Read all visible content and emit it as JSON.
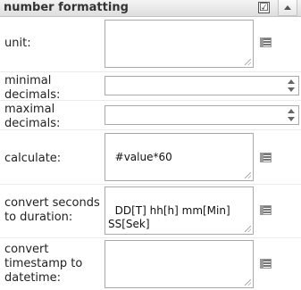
{
  "header": {
    "title": "number formatting",
    "checkbox_glyph": "☑",
    "collapse_icon": "triangle-up"
  },
  "fields": {
    "unit": {
      "label": "unit:",
      "value": ""
    },
    "minimal_decimals": {
      "label": "minimal\ndecimals:",
      "value": ""
    },
    "maximal_decimals": {
      "label": "maximal\ndecimals:",
      "value": ""
    },
    "calculate": {
      "label": "calculate:",
      "value": "#value*60"
    },
    "convert_seconds": {
      "label": "convert seconds\nto duration:",
      "value": "DD[T] hh[h] mm[Min]\nSS[Sek]"
    },
    "convert_timestamp": {
      "label": "convert\ntimestamp to\ndatetime:",
      "value": ""
    }
  }
}
